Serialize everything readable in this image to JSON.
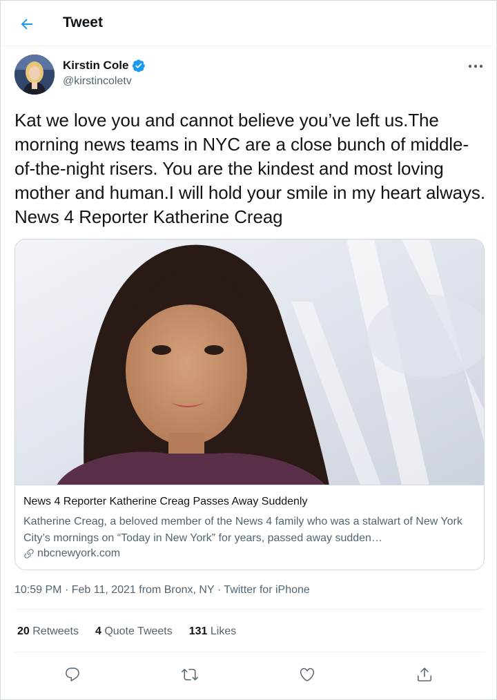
{
  "header": {
    "title": "Tweet"
  },
  "author": {
    "name": "Kirstin Cole",
    "handle": "@kirstincoletv"
  },
  "tweet": {
    "text": "Kat we love you and cannot believe you’ve left us.The morning news teams in NYC are a close bunch of middle-of-the-night risers. You are the kindest and most loving mother and human.I will hold your smile in my heart always. News 4 Reporter Katherine Creag"
  },
  "card": {
    "title": "News 4 Reporter Katherine Creag Passes Away Suddenly",
    "description": "Katherine Creag, a beloved member of the News 4 family who was a stalwart of New York City’s mornings on “Today in New York” for years, passed away sudden…",
    "domain": "nbcnewyork.com"
  },
  "meta": {
    "time": "10:59 PM",
    "date": "Feb 11, 2021",
    "location": "from Bronx, NY",
    "source": "Twitter for iPhone",
    "separator": "·"
  },
  "stats": {
    "retweets": {
      "count": "20",
      "label": "Retweets"
    },
    "quotes": {
      "count": "4",
      "label": "Quote Tweets"
    },
    "likes": {
      "count": "131",
      "label": "Likes"
    }
  },
  "colors": {
    "accent": "#1d9bf0",
    "secondary_text": "#536471",
    "border": "#cfd9de"
  },
  "icons": {
    "back": "arrow-left-icon",
    "verified": "verified-badge-icon",
    "more": "more-horizontal-icon",
    "link": "link-icon",
    "reply": "reply-icon",
    "retweet": "retweet-icon",
    "like": "heart-icon",
    "share": "share-icon"
  }
}
